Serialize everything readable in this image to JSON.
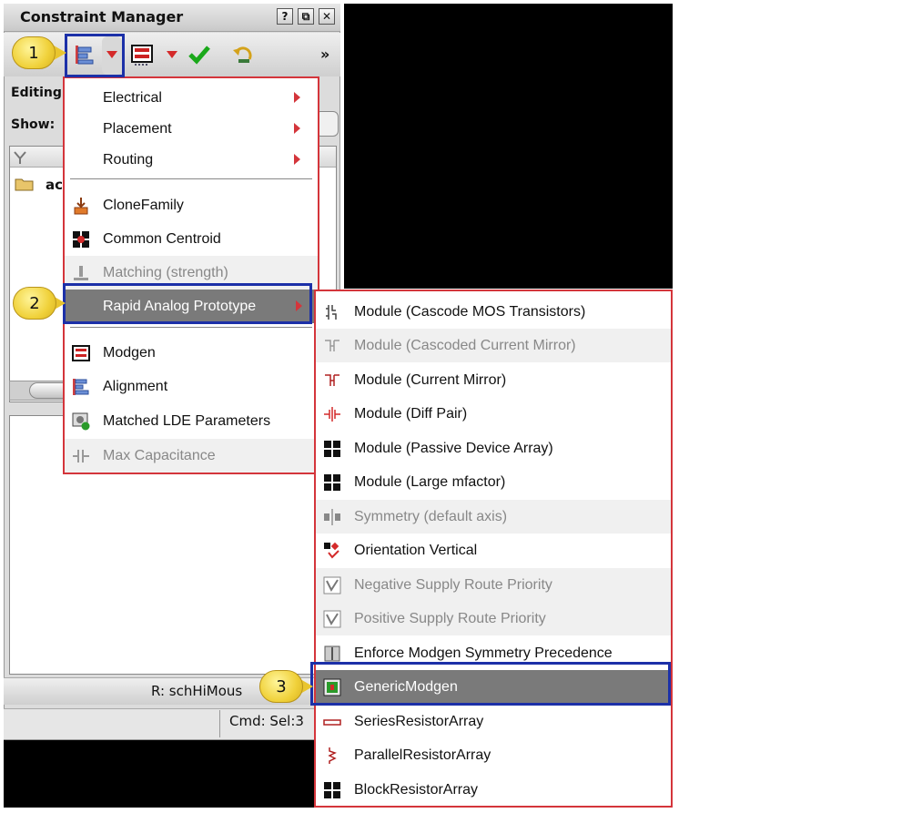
{
  "window": {
    "title": "Constraint Manager",
    "controls": [
      "?",
      "⧉",
      "✕"
    ],
    "overflow": "»"
  },
  "panel": {
    "editing_label": "Editing",
    "show_label": "Show:",
    "tree_item": "ac",
    "status_right": "R: schHiMous",
    "status_cmd": "Cmd: Sel:3"
  },
  "callouts": [
    "1",
    "2",
    "3"
  ],
  "menu1": {
    "items": [
      {
        "label": "Electrical",
        "submenu": true
      },
      {
        "label": "Placement",
        "submenu": true
      },
      {
        "label": "Routing",
        "submenu": true
      },
      {
        "label": "CloneFamily"
      },
      {
        "label": "Common Centroid"
      },
      {
        "label": "Matching (strength)",
        "disabled": true
      },
      {
        "label": "Rapid Analog Prototype",
        "submenu": true,
        "highlighted": true
      },
      {
        "label": "Modgen"
      },
      {
        "label": "Alignment"
      },
      {
        "label": "Matched LDE Parameters"
      },
      {
        "label": "Max Capacitance",
        "disabled": true
      }
    ]
  },
  "menu2": {
    "items": [
      {
        "label": "Module (Cascode MOS Transistors)"
      },
      {
        "label": "Module (Cascoded Current Mirror)",
        "disabled": true
      },
      {
        "label": "Module (Current Mirror)"
      },
      {
        "label": "Module (Diff Pair)"
      },
      {
        "label": "Module (Passive Device Array)"
      },
      {
        "label": "Module (Large mfactor)"
      },
      {
        "label": "Symmetry (default axis)",
        "disabled": true
      },
      {
        "label": "Orientation Vertical"
      },
      {
        "label": "Negative Supply Route Priority",
        "disabled": true
      },
      {
        "label": "Positive Supply Route Priority",
        "disabled": true
      },
      {
        "label": "Enforce Modgen Symmetry Precedence"
      },
      {
        "label": "GenericModgen",
        "highlighted": true
      },
      {
        "label": "SeriesResistorArray"
      },
      {
        "label": "ParallelResistorArray"
      },
      {
        "label": "BlockResistorArray"
      }
    ]
  },
  "colors": {
    "menu_border": "#d4353b",
    "highlight": "#7a7a7a",
    "focus_box": "#1c30a8",
    "callout": "#f0d13a"
  }
}
